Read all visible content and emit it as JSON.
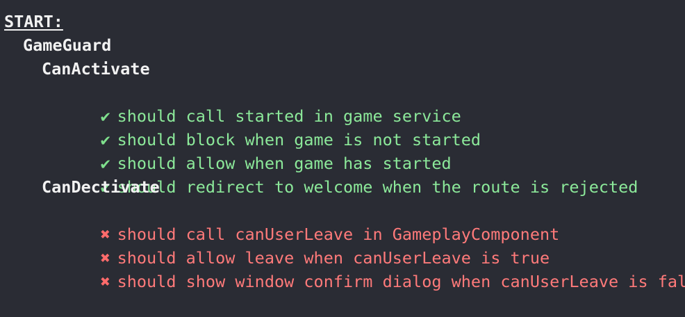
{
  "header": {
    "label": "START:"
  },
  "suite": {
    "name": "GameGuard",
    "groups": [
      {
        "name": "CanActivate",
        "tests": [
          {
            "status": "pass",
            "icon": "✔",
            "text": "should call started in game service"
          },
          {
            "status": "pass",
            "icon": "✔",
            "text": "should block when game is not started"
          },
          {
            "status": "pass",
            "icon": "✔",
            "text": "should allow when game has started"
          },
          {
            "status": "pass",
            "icon": "✔",
            "text": "should redirect to welcome when the route is rejected"
          }
        ]
      },
      {
        "name": "CanDectivate",
        "tests": [
          {
            "status": "fail",
            "icon": "✖",
            "text": "should call canUserLeave in GameplayComponent"
          },
          {
            "status": "fail",
            "icon": "✖",
            "text": "should allow leave when canUserLeave is true"
          },
          {
            "status": "fail",
            "icon": "✖",
            "text": "should show window confirm dialog when canUserLeave is false"
          }
        ]
      }
    ]
  },
  "colors": {
    "background": "#2a2c34",
    "pass": "#8ce99a",
    "fail": "#ff7a7a",
    "text": "#f2f2f2"
  },
  "icons": {
    "pass": "check-icon",
    "fail": "cross-icon"
  }
}
